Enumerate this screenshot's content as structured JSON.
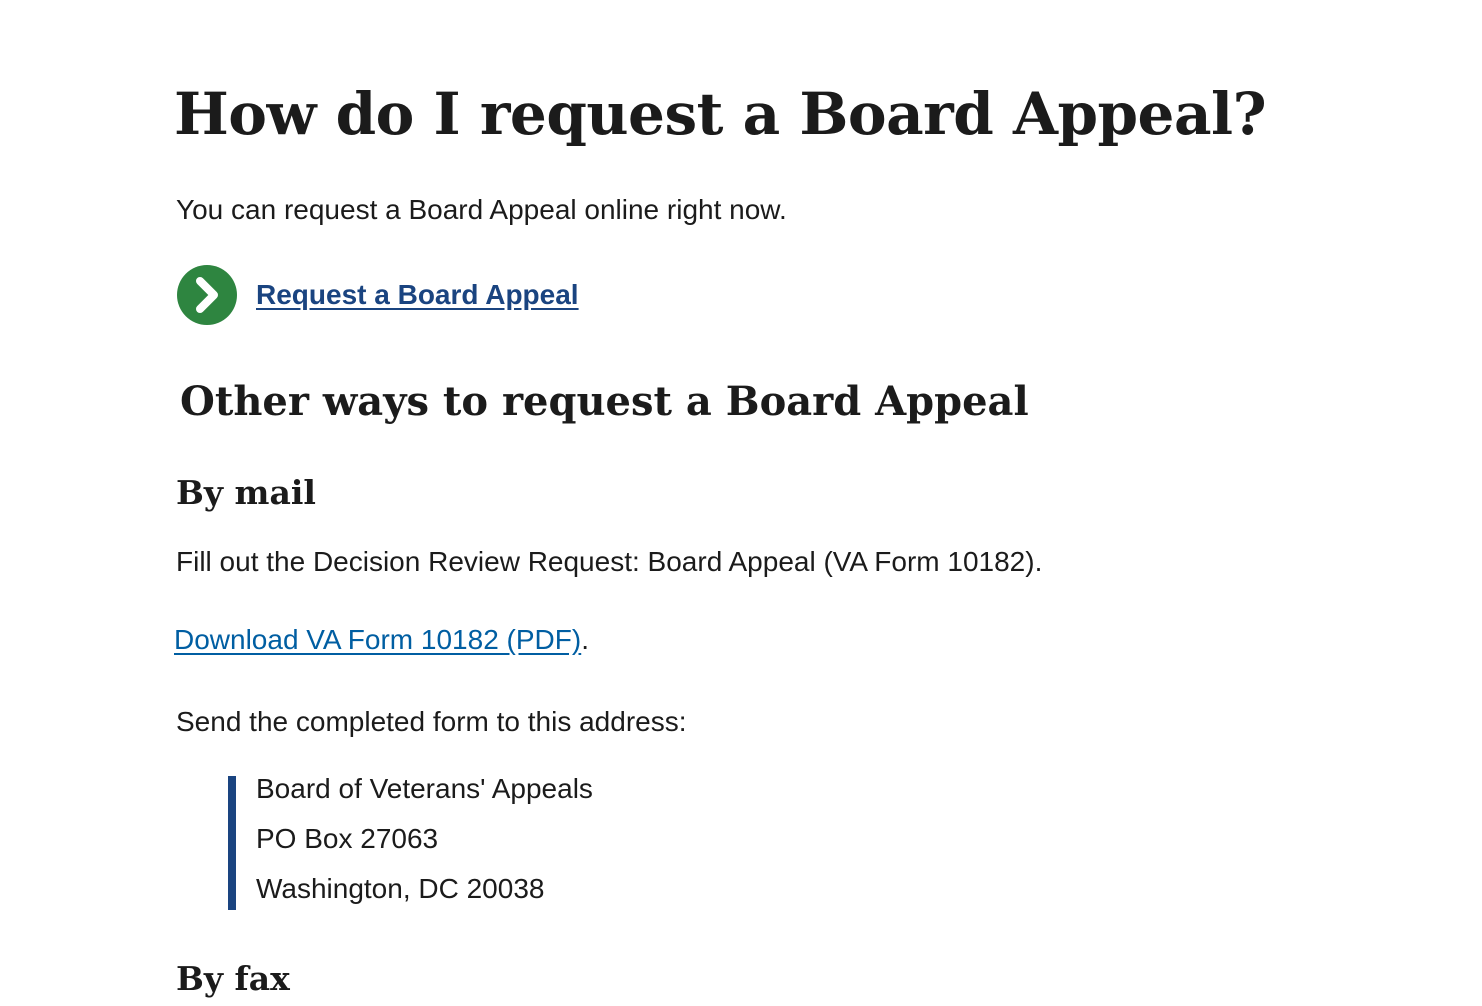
{
  "page": {
    "heading": "How do I request a Board Appeal?",
    "intro": "You can request a Board Appeal online right now.",
    "action_link": {
      "label": "Request a Board Appeal",
      "icon": "chevron-right-circle-icon",
      "icon_color": "#2e8540"
    },
    "other_ways_heading": "Other ways to request a Board Appeal",
    "mail": {
      "heading": "By mail",
      "instruction": "Fill out the Decision Review Request: Board Appeal (VA Form 10182).",
      "download_link": "Download VA Form 10182 (PDF)",
      "download_suffix": ".",
      "send_text": "Send the completed form to this address:",
      "address": [
        "Board of Veterans' Appeals",
        "PO Box 27063",
        "Washington, DC 20038"
      ]
    },
    "fax": {
      "heading": "By fax"
    }
  },
  "colors": {
    "text": "#1b1b1b",
    "link": "#005ea2",
    "action_link": "#1a4480",
    "action_icon": "#2e8540",
    "address_border": "#1a4480"
  }
}
